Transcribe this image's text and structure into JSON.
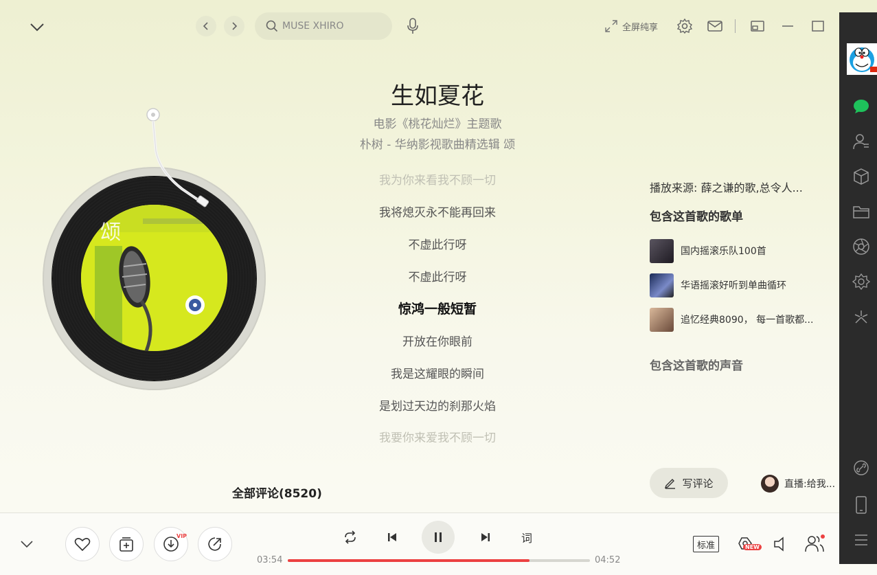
{
  "header": {
    "search_placeholder": "MUSE XHIRO",
    "fullscreen_label": "全屏纯享"
  },
  "song": {
    "title": "生如夏花",
    "subtitle": "电影《桃花灿烂》主题歌",
    "meta": "朴树 - 华纳影视歌曲精选辑 颂"
  },
  "lyrics": [
    {
      "text": "我为你来看我不顾一切",
      "state": "fade"
    },
    {
      "text": "我将熄灭永不能再回来",
      "state": "normal"
    },
    {
      "text": "不虚此行呀",
      "state": "normal"
    },
    {
      "text": "不虚此行呀",
      "state": "normal"
    },
    {
      "text": "惊鸿一般短暂",
      "state": "active"
    },
    {
      "text": "开放在你眼前",
      "state": "normal"
    },
    {
      "text": "我是这耀眼的瞬间",
      "state": "normal"
    },
    {
      "text": "是划过天边的刹那火焰",
      "state": "normal"
    },
    {
      "text": "我要你来爱我不顾一切",
      "state": "fade"
    }
  ],
  "side_panel": {
    "source": "播放来源: 薛之谦的歌,总令人...",
    "playlists_title": "包含这首歌的歌单",
    "playlists": [
      {
        "name": "国内摇滚乐队100首",
        "thumb_color": "#3b3540"
      },
      {
        "name": "华语摇滚好听到单曲循环",
        "thumb_color": "#2e3a5a"
      },
      {
        "name": "追忆经典8090， 每一首歌都...",
        "thumb_color": "#b78a6a"
      }
    ],
    "voices_title": "包含这首歌的声音"
  },
  "comments": {
    "title": "全部评论(8520)",
    "write_label": "写评论",
    "live_label": "直播:给我..."
  },
  "player": {
    "current_time": "03:54",
    "total_time": "04:52",
    "progress": 0.8,
    "lyrics_button": "词",
    "quality_label": "标准",
    "vip_badge": "VIP",
    "new_badge": "NEW",
    "accent_color": "#ec4141"
  },
  "album": {
    "art_text": "颂"
  }
}
